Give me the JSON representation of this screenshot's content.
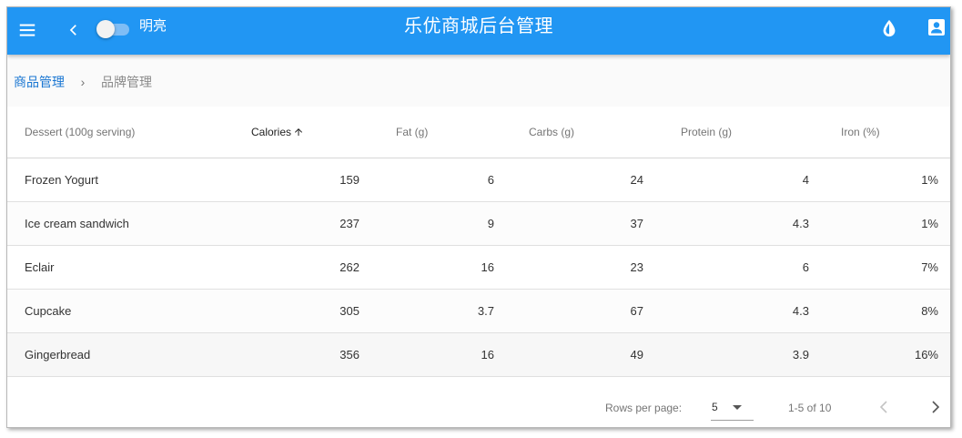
{
  "app": {
    "title": "乐优商城后台管理",
    "switch_label": "明亮",
    "theme_color": "#2196f3"
  },
  "breadcrumb": {
    "parent": "商品管理",
    "separator": "›",
    "current": "品牌管理"
  },
  "table": {
    "headers": {
      "name": "Dessert (100g serving)",
      "calories": "Calories",
      "fat": "Fat (g)",
      "carbs": "Carbs (g)",
      "protein": "Protein (g)",
      "iron": "Iron (%)"
    },
    "sorted_by": "calories",
    "sort_direction": "ascending",
    "rows": [
      {
        "name": "Frozen Yogurt",
        "calories": "159",
        "fat": "6",
        "carbs": "24",
        "protein": "4",
        "iron": "1%"
      },
      {
        "name": "Ice cream sandwich",
        "calories": "237",
        "fat": "9",
        "carbs": "37",
        "protein": "4.3",
        "iron": "1%"
      },
      {
        "name": "Eclair",
        "calories": "262",
        "fat": "16",
        "carbs": "23",
        "protein": "6",
        "iron": "7%"
      },
      {
        "name": "Cupcake",
        "calories": "305",
        "fat": "3.7",
        "carbs": "67",
        "protein": "4.3",
        "iron": "8%"
      },
      {
        "name": "Gingerbread",
        "calories": "356",
        "fat": "16",
        "carbs": "49",
        "protein": "3.9",
        "iron": "16%"
      }
    ]
  },
  "pagination": {
    "rows_per_page_label": "Rows per page:",
    "rows_per_page_value": "5",
    "range_text": "1-5 of 10"
  },
  "icons": {
    "menu": "menu-icon",
    "back": "chevron-left-icon",
    "theme": "water-drop-icon",
    "account": "account-box-icon",
    "sort": "arrow-up-icon",
    "prev": "chevron-left-icon",
    "next": "chevron-right-icon"
  }
}
